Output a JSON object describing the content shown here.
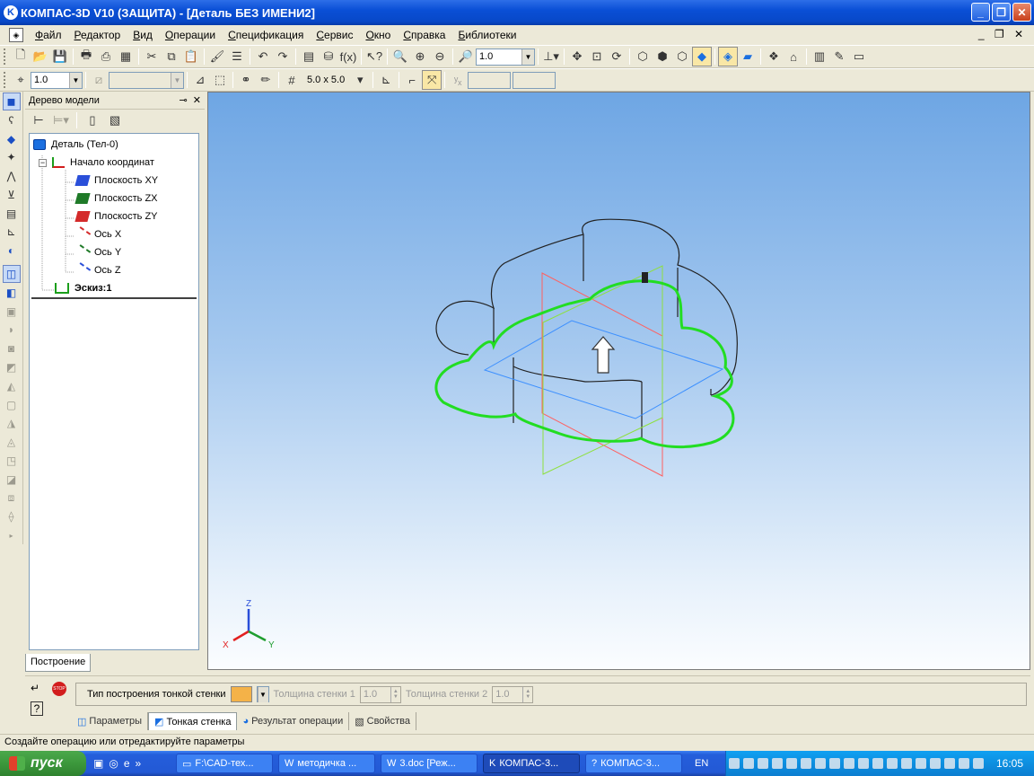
{
  "window": {
    "title": "КОМПАС-3D V10 (ЗАЩИТА) - [Деталь БЕЗ ИМЕНИ2]"
  },
  "menu": [
    "Файл",
    "Редактор",
    "Вид",
    "Операции",
    "Спецификация",
    "Сервис",
    "Окно",
    "Справка",
    "Библиотеки"
  ],
  "toolbar1": {
    "zoom_value": "1.0"
  },
  "toolbar2": {
    "scale_value": "1.0",
    "grid_label": "5.0 x 5.0"
  },
  "tree": {
    "title": "Дерево модели",
    "root": "Деталь (Тел-0)",
    "items": [
      "Начало координат",
      "Плоскость XY",
      "Плоскость ZX",
      "Плоскость ZY",
      "Ось X",
      "Ось Y",
      "Ось Z",
      "Эскиз:1"
    ],
    "tab": "Построение"
  },
  "axes": {
    "x": "X",
    "y": "Y",
    "z": "Z"
  },
  "properties": {
    "type_label": "Тип построения тонкой стенки",
    "thickness1_label": "Толщина стенки 1",
    "thickness1_value": "1.0",
    "thickness2_label": "Толщина стенки 2",
    "thickness2_value": "1.0",
    "tabs": [
      "Параметры",
      "Тонкая стенка",
      "Результат операции",
      "Свойства"
    ]
  },
  "status": "Создайте операцию или отредактируйте параметры",
  "taskbar": {
    "start": "пуск",
    "tasks": [
      "F:\\CAD-тех...",
      "методичка ...",
      "3.doc [Реж...",
      "КОМПАС-3...",
      "КОМПАС-3..."
    ],
    "lang": "EN",
    "clock": "16:05"
  },
  "colors": {
    "accent": "#0a4fd6",
    "sketch": "#22dd22",
    "plane_xy": "#3b8fff",
    "plane_zx": "#ff6060",
    "plane_zy": "#8ee040"
  }
}
